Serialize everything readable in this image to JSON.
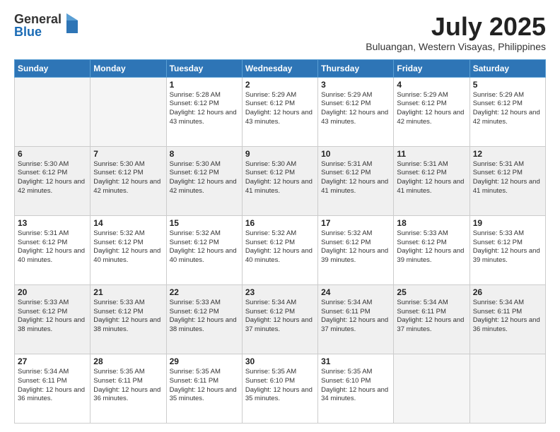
{
  "logo": {
    "general": "General",
    "blue": "Blue"
  },
  "title": "July 2025",
  "subtitle": "Buluangan, Western Visayas, Philippines",
  "days_of_week": [
    "Sunday",
    "Monday",
    "Tuesday",
    "Wednesday",
    "Thursday",
    "Friday",
    "Saturday"
  ],
  "weeks": [
    [
      {
        "day": "",
        "info": ""
      },
      {
        "day": "",
        "info": ""
      },
      {
        "day": "1",
        "info": "Sunrise: 5:28 AM\nSunset: 6:12 PM\nDaylight: 12 hours and 43 minutes."
      },
      {
        "day": "2",
        "info": "Sunrise: 5:29 AM\nSunset: 6:12 PM\nDaylight: 12 hours and 43 minutes."
      },
      {
        "day": "3",
        "info": "Sunrise: 5:29 AM\nSunset: 6:12 PM\nDaylight: 12 hours and 43 minutes."
      },
      {
        "day": "4",
        "info": "Sunrise: 5:29 AM\nSunset: 6:12 PM\nDaylight: 12 hours and 42 minutes."
      },
      {
        "day": "5",
        "info": "Sunrise: 5:29 AM\nSunset: 6:12 PM\nDaylight: 12 hours and 42 minutes."
      }
    ],
    [
      {
        "day": "6",
        "info": "Sunrise: 5:30 AM\nSunset: 6:12 PM\nDaylight: 12 hours and 42 minutes."
      },
      {
        "day": "7",
        "info": "Sunrise: 5:30 AM\nSunset: 6:12 PM\nDaylight: 12 hours and 42 minutes."
      },
      {
        "day": "8",
        "info": "Sunrise: 5:30 AM\nSunset: 6:12 PM\nDaylight: 12 hours and 42 minutes."
      },
      {
        "day": "9",
        "info": "Sunrise: 5:30 AM\nSunset: 6:12 PM\nDaylight: 12 hours and 41 minutes."
      },
      {
        "day": "10",
        "info": "Sunrise: 5:31 AM\nSunset: 6:12 PM\nDaylight: 12 hours and 41 minutes."
      },
      {
        "day": "11",
        "info": "Sunrise: 5:31 AM\nSunset: 6:12 PM\nDaylight: 12 hours and 41 minutes."
      },
      {
        "day": "12",
        "info": "Sunrise: 5:31 AM\nSunset: 6:12 PM\nDaylight: 12 hours and 41 minutes."
      }
    ],
    [
      {
        "day": "13",
        "info": "Sunrise: 5:31 AM\nSunset: 6:12 PM\nDaylight: 12 hours and 40 minutes."
      },
      {
        "day": "14",
        "info": "Sunrise: 5:32 AM\nSunset: 6:12 PM\nDaylight: 12 hours and 40 minutes."
      },
      {
        "day": "15",
        "info": "Sunrise: 5:32 AM\nSunset: 6:12 PM\nDaylight: 12 hours and 40 minutes."
      },
      {
        "day": "16",
        "info": "Sunrise: 5:32 AM\nSunset: 6:12 PM\nDaylight: 12 hours and 40 minutes."
      },
      {
        "day": "17",
        "info": "Sunrise: 5:32 AM\nSunset: 6:12 PM\nDaylight: 12 hours and 39 minutes."
      },
      {
        "day": "18",
        "info": "Sunrise: 5:33 AM\nSunset: 6:12 PM\nDaylight: 12 hours and 39 minutes."
      },
      {
        "day": "19",
        "info": "Sunrise: 5:33 AM\nSunset: 6:12 PM\nDaylight: 12 hours and 39 minutes."
      }
    ],
    [
      {
        "day": "20",
        "info": "Sunrise: 5:33 AM\nSunset: 6:12 PM\nDaylight: 12 hours and 38 minutes."
      },
      {
        "day": "21",
        "info": "Sunrise: 5:33 AM\nSunset: 6:12 PM\nDaylight: 12 hours and 38 minutes."
      },
      {
        "day": "22",
        "info": "Sunrise: 5:33 AM\nSunset: 6:12 PM\nDaylight: 12 hours and 38 minutes."
      },
      {
        "day": "23",
        "info": "Sunrise: 5:34 AM\nSunset: 6:12 PM\nDaylight: 12 hours and 37 minutes."
      },
      {
        "day": "24",
        "info": "Sunrise: 5:34 AM\nSunset: 6:11 PM\nDaylight: 12 hours and 37 minutes."
      },
      {
        "day": "25",
        "info": "Sunrise: 5:34 AM\nSunset: 6:11 PM\nDaylight: 12 hours and 37 minutes."
      },
      {
        "day": "26",
        "info": "Sunrise: 5:34 AM\nSunset: 6:11 PM\nDaylight: 12 hours and 36 minutes."
      }
    ],
    [
      {
        "day": "27",
        "info": "Sunrise: 5:34 AM\nSunset: 6:11 PM\nDaylight: 12 hours and 36 minutes."
      },
      {
        "day": "28",
        "info": "Sunrise: 5:35 AM\nSunset: 6:11 PM\nDaylight: 12 hours and 36 minutes."
      },
      {
        "day": "29",
        "info": "Sunrise: 5:35 AM\nSunset: 6:11 PM\nDaylight: 12 hours and 35 minutes."
      },
      {
        "day": "30",
        "info": "Sunrise: 5:35 AM\nSunset: 6:10 PM\nDaylight: 12 hours and 35 minutes."
      },
      {
        "day": "31",
        "info": "Sunrise: 5:35 AM\nSunset: 6:10 PM\nDaylight: 12 hours and 34 minutes."
      },
      {
        "day": "",
        "info": ""
      },
      {
        "day": "",
        "info": ""
      }
    ]
  ]
}
